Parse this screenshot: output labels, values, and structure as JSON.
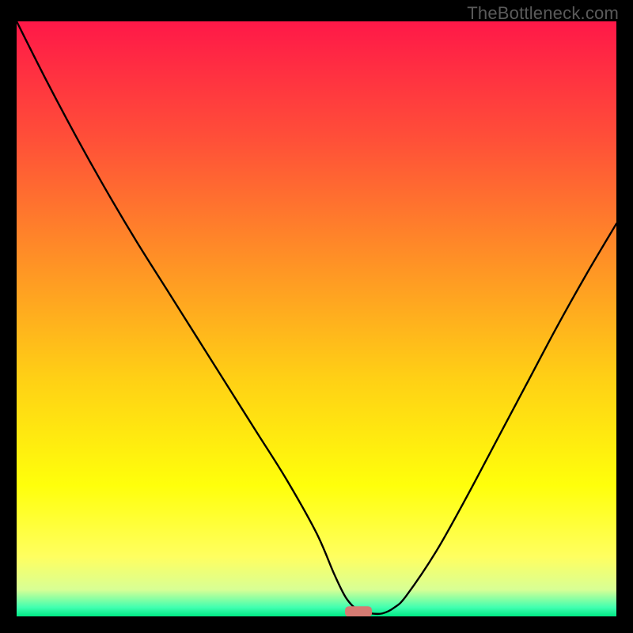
{
  "watermark": "TheBottleneck.com",
  "chart_data": {
    "type": "line",
    "title": "",
    "xlabel": "",
    "ylabel": "",
    "xlim": [
      0,
      100
    ],
    "ylim": [
      0,
      100
    ],
    "grid": false,
    "legend": false,
    "background": {
      "style": "vertical-gradient",
      "description": "red at top through orange/yellow to thin green band at bottom",
      "stops": [
        {
          "pos": 0.0,
          "color": "#ff1848"
        },
        {
          "pos": 0.2,
          "color": "#ff5038"
        },
        {
          "pos": 0.4,
          "color": "#ff9026"
        },
        {
          "pos": 0.6,
          "color": "#ffd015"
        },
        {
          "pos": 0.78,
          "color": "#ffff0b"
        },
        {
          "pos": 0.9,
          "color": "#ffff60"
        },
        {
          "pos": 0.955,
          "color": "#d8ff95"
        },
        {
          "pos": 0.985,
          "color": "#40ffb0"
        },
        {
          "pos": 1.0,
          "color": "#00e884"
        }
      ]
    },
    "series": [
      {
        "name": "curve",
        "stroke": "#000000",
        "x": [
          0,
          5,
          10,
          15,
          20,
          25,
          30,
          35,
          40,
          45,
          50,
          53,
          55,
          57,
          59,
          61,
          63,
          65,
          70,
          75,
          80,
          85,
          90,
          95,
          100
        ],
        "y": [
          100,
          90,
          80.5,
          71.5,
          63,
          55,
          47,
          39,
          31,
          23,
          14,
          7,
          3,
          1,
          0.5,
          0.5,
          1.5,
          3.5,
          11,
          20,
          29.5,
          39,
          48.5,
          57.5,
          66
        ]
      }
    ],
    "marker": {
      "shape": "rounded-rect",
      "x": 57,
      "y": 0.8,
      "width": 4.5,
      "height": 1.8,
      "color": "#d57a72"
    }
  }
}
